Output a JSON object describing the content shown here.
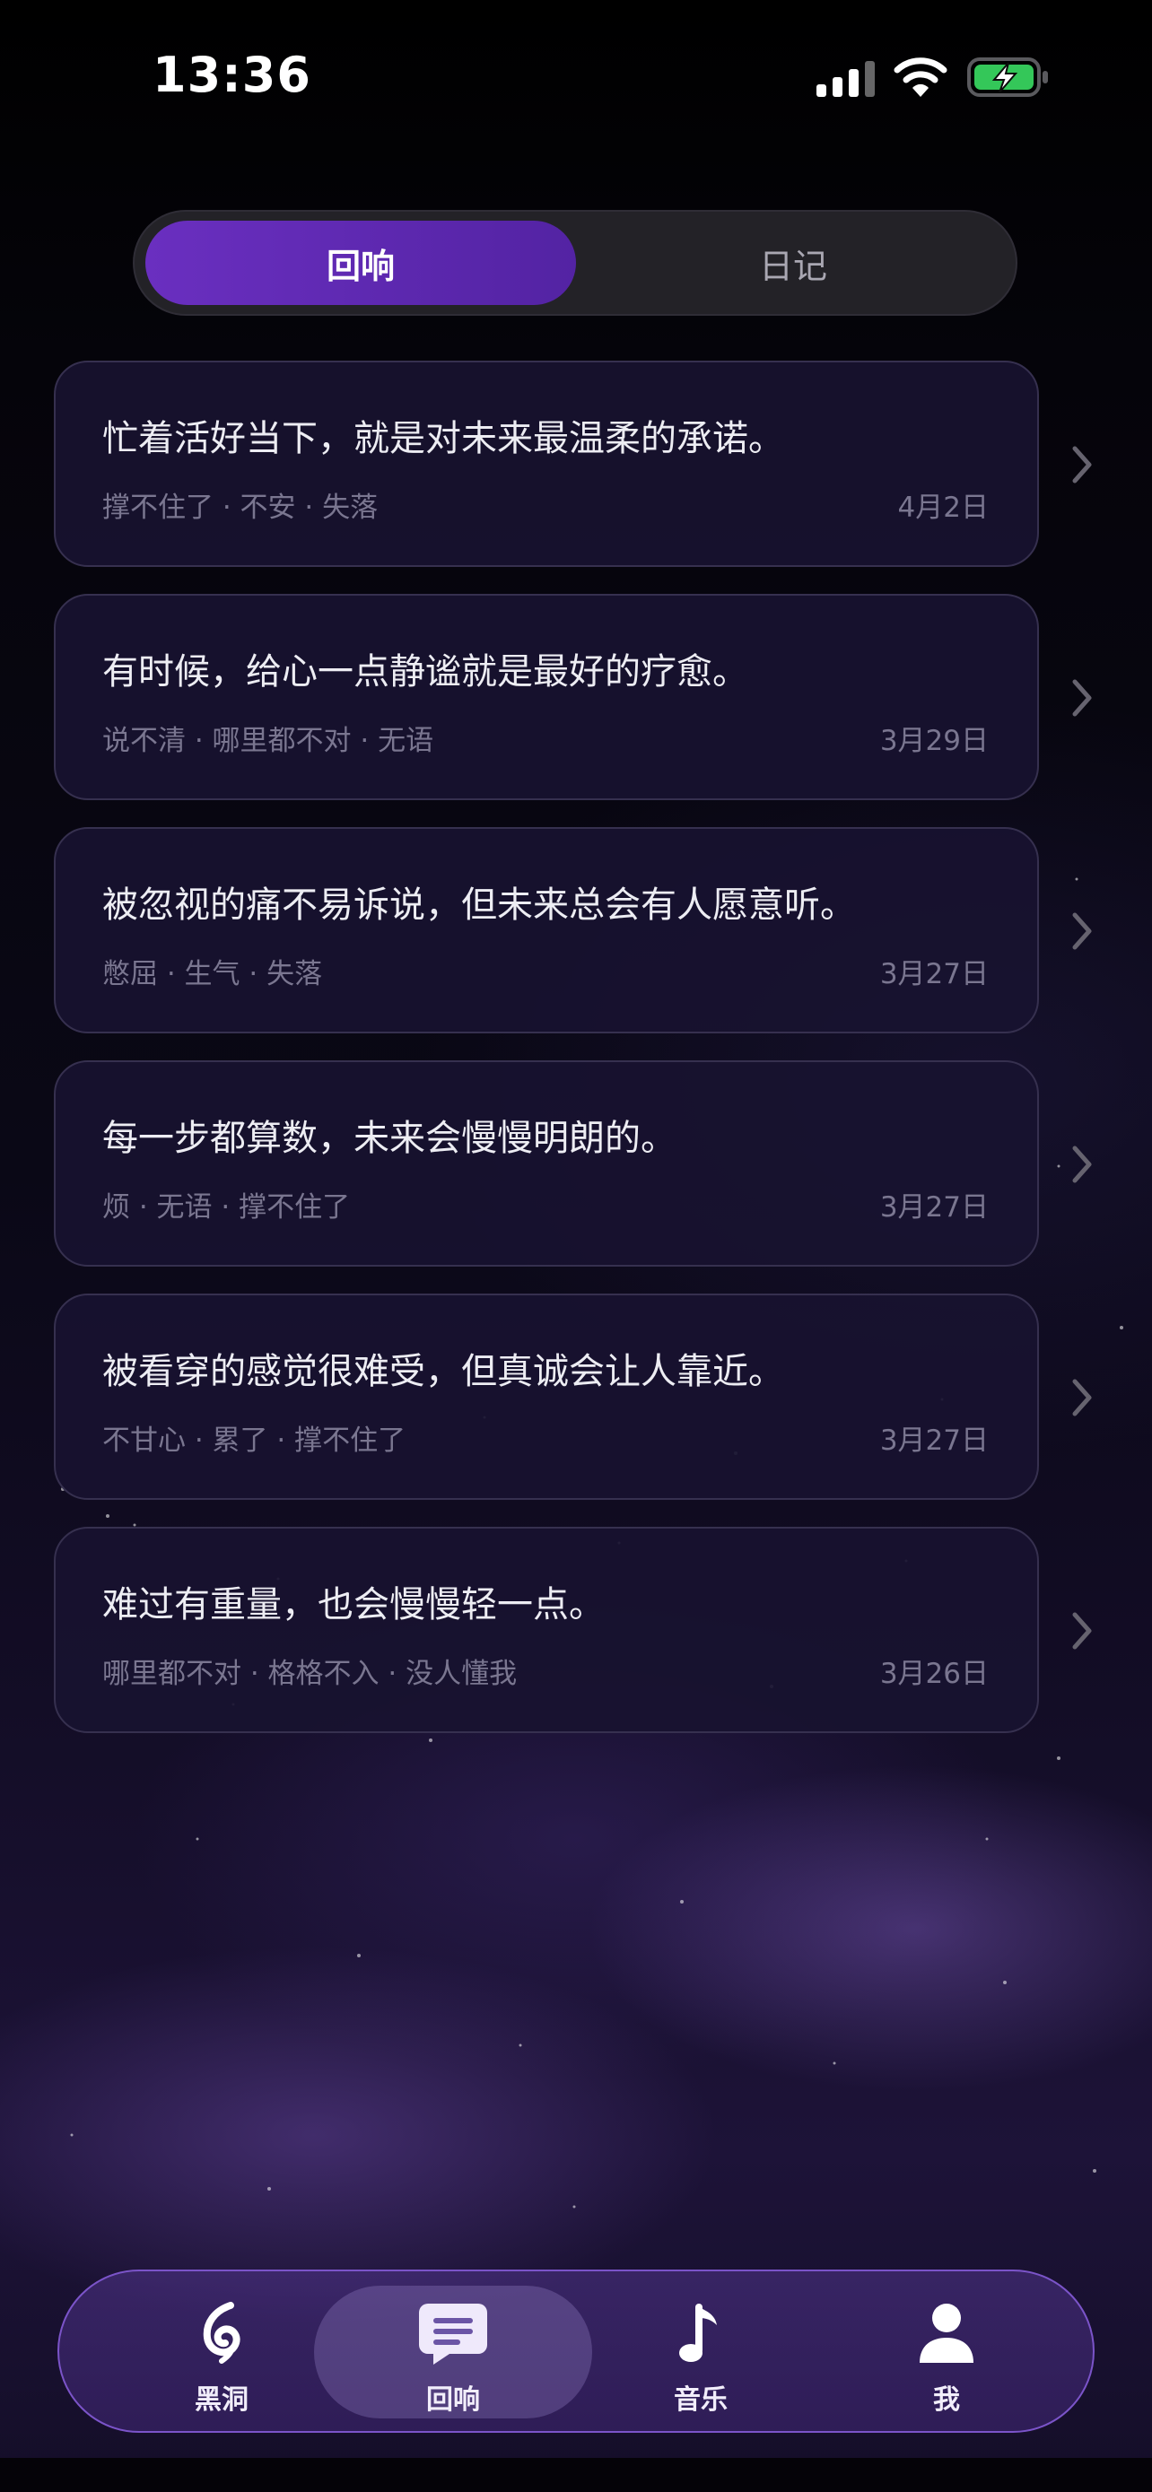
{
  "status_bar": {
    "time": "13:36"
  },
  "segment": {
    "tabs": [
      "回响",
      "日记"
    ],
    "selected": "回响"
  },
  "entries": [
    {
      "quote": "忙着活好当下，就是对未来最温柔的承诺。",
      "tags": "撑不住了 · 不安 · 失落",
      "date": "4月2日"
    },
    {
      "quote": "有时候，给心一点静谧就是最好的疗愈。",
      "tags": "说不清 · 哪里都不对 · 无语",
      "date": "3月29日"
    },
    {
      "quote": "被忽视的痛不易诉说，但未来总会有人愿意听。",
      "tags": "憋屈 · 生气 · 失落",
      "date": "3月27日"
    },
    {
      "quote": "每一步都算数，未来会慢慢明朗的。",
      "tags": "烦 · 无语 · 撑不住了",
      "date": "3月27日"
    },
    {
      "quote": "被看穿的感觉很难受，但真诚会让人靠近。",
      "tags": "不甘心 · 累了 · 撑不住了",
      "date": "3月27日"
    },
    {
      "quote": "难过有重量，也会慢慢轻一点。",
      "tags": "哪里都不对 · 格格不入 · 没人懂我",
      "date": "3月26日"
    }
  ],
  "tab_bar": {
    "items": [
      {
        "label": "黑洞",
        "icon": "black-hole-icon"
      },
      {
        "label": "回响",
        "icon": "chat-bubble-icon"
      },
      {
        "label": "音乐",
        "icon": "music-note-icon"
      },
      {
        "label": "我",
        "icon": "person-icon"
      }
    ],
    "selected": "回响"
  },
  "colors": {
    "accent": "#6a2fc0",
    "battery": "#34c759"
  }
}
